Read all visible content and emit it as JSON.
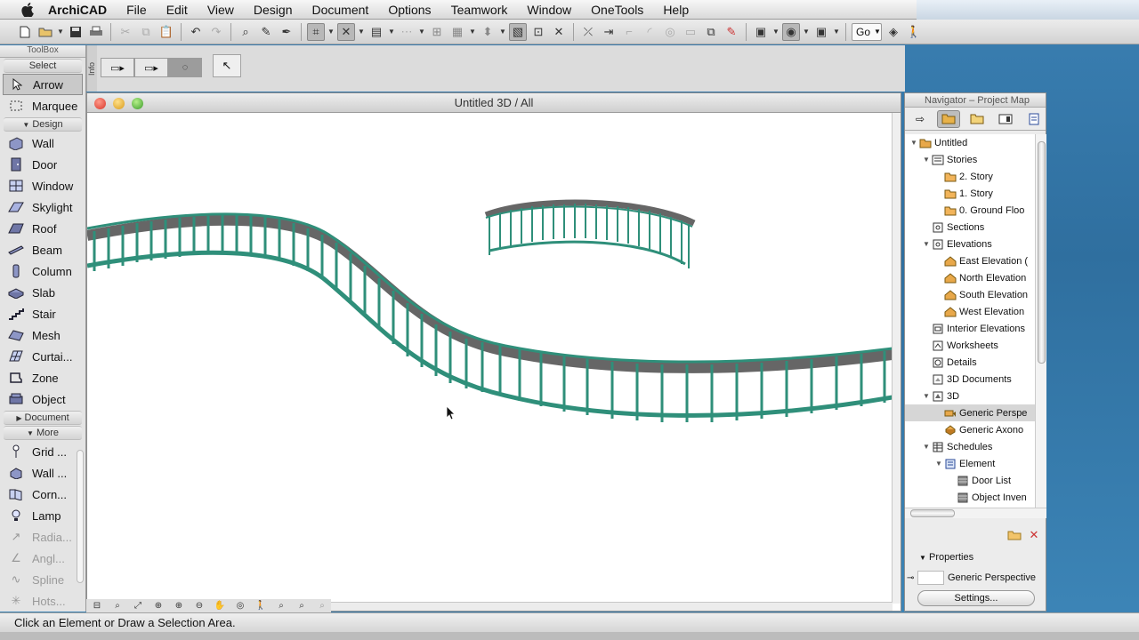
{
  "menubar": {
    "app_name": "ArchiCAD",
    "items": [
      "File",
      "Edit",
      "View",
      "Design",
      "Document",
      "Options",
      "Teamwork",
      "Window",
      "OneTools",
      "Help"
    ]
  },
  "toolbar": {
    "go_label": "Go"
  },
  "infobar": {
    "label": "Info"
  },
  "toolbox": {
    "title": "ToolBox",
    "select_label": "Select",
    "select_tools": [
      {
        "label": "Arrow",
        "icon": "arrow-icon",
        "selected": true
      },
      {
        "label": "Marquee",
        "icon": "marquee-icon"
      }
    ],
    "design_label": "Design",
    "design_tools": [
      {
        "label": "Wall",
        "icon": "wall-icon"
      },
      {
        "label": "Door",
        "icon": "door-icon"
      },
      {
        "label": "Window",
        "icon": "window-icon"
      },
      {
        "label": "Skylight",
        "icon": "skylight-icon"
      },
      {
        "label": "Roof",
        "icon": "roof-icon"
      },
      {
        "label": "Beam",
        "icon": "beam-icon"
      },
      {
        "label": "Column",
        "icon": "column-icon"
      },
      {
        "label": "Slab",
        "icon": "slab-icon"
      },
      {
        "label": "Stair",
        "icon": "stair-icon"
      },
      {
        "label": "Mesh",
        "icon": "mesh-icon"
      },
      {
        "label": "Curtai...",
        "icon": "curtain-wall-icon"
      },
      {
        "label": "Zone",
        "icon": "zone-icon"
      },
      {
        "label": "Object",
        "icon": "object-icon"
      }
    ],
    "document_label": "Document",
    "more_label": "More",
    "more_tools": [
      {
        "label": "Grid ...",
        "icon": "grid-icon"
      },
      {
        "label": "Wall ...",
        "icon": "wall-end-icon"
      },
      {
        "label": "Corn...",
        "icon": "corner-window-icon"
      },
      {
        "label": "Lamp",
        "icon": "lamp-icon"
      },
      {
        "label": "Radia...",
        "icon": "radial-dimension-icon",
        "disabled": true
      },
      {
        "label": "Angl...",
        "icon": "angle-dimension-icon",
        "disabled": true
      },
      {
        "label": "Spline",
        "icon": "spline-icon",
        "disabled": true
      },
      {
        "label": "Hots...",
        "icon": "hotspot-icon",
        "disabled": true
      }
    ]
  },
  "window3d": {
    "title": "Untitled 3D / All"
  },
  "navigator": {
    "title": "Navigator – Project Map",
    "tree": [
      {
        "label": "Untitled",
        "depth": 0,
        "toggle": "open",
        "icon": "project-icon"
      },
      {
        "label": "Stories",
        "depth": 1,
        "toggle": "open",
        "icon": "stories-icon"
      },
      {
        "label": "2. Story",
        "depth": 2,
        "icon": "folder-icon"
      },
      {
        "label": "1. Story",
        "depth": 2,
        "icon": "folder-icon"
      },
      {
        "label": "0. Ground Floo",
        "depth": 2,
        "icon": "folder-icon"
      },
      {
        "label": "Sections",
        "depth": 1,
        "icon": "sections-icon"
      },
      {
        "label": "Elevations",
        "depth": 1,
        "toggle": "open",
        "icon": "elevations-icon"
      },
      {
        "label": "East Elevation (",
        "depth": 2,
        "icon": "house-icon"
      },
      {
        "label": "North Elevation",
        "depth": 2,
        "icon": "house-icon"
      },
      {
        "label": "South Elevation",
        "depth": 2,
        "icon": "house-icon"
      },
      {
        "label": "West Elevation",
        "depth": 2,
        "icon": "house-icon"
      },
      {
        "label": "Interior Elevations",
        "depth": 1,
        "icon": "interior-elevations-icon"
      },
      {
        "label": "Worksheets",
        "depth": 1,
        "icon": "worksheets-icon"
      },
      {
        "label": "Details",
        "depth": 1,
        "icon": "details-icon"
      },
      {
        "label": "3D Documents",
        "depth": 1,
        "icon": "3d-documents-icon"
      },
      {
        "label": "3D",
        "depth": 1,
        "toggle": "open",
        "icon": "3d-icon"
      },
      {
        "label": "Generic Perspe",
        "depth": 2,
        "icon": "perspective-icon",
        "selected": true
      },
      {
        "label": "Generic Axono",
        "depth": 2,
        "icon": "axonometry-icon"
      },
      {
        "label": "Schedules",
        "depth": 1,
        "toggle": "open",
        "icon": "schedules-icon"
      },
      {
        "label": "Element",
        "depth": 2,
        "toggle": "open",
        "icon": "element-icon"
      },
      {
        "label": "Door List",
        "depth": 3,
        "icon": "list-icon"
      },
      {
        "label": "Object Inven",
        "depth": 3,
        "icon": "list-icon"
      }
    ],
    "properties_label": "Properties",
    "properties_value": "Generic Perspective",
    "settings_label": "Settings..."
  },
  "status": {
    "text": "Click an Element or Draw a Selection Area."
  }
}
